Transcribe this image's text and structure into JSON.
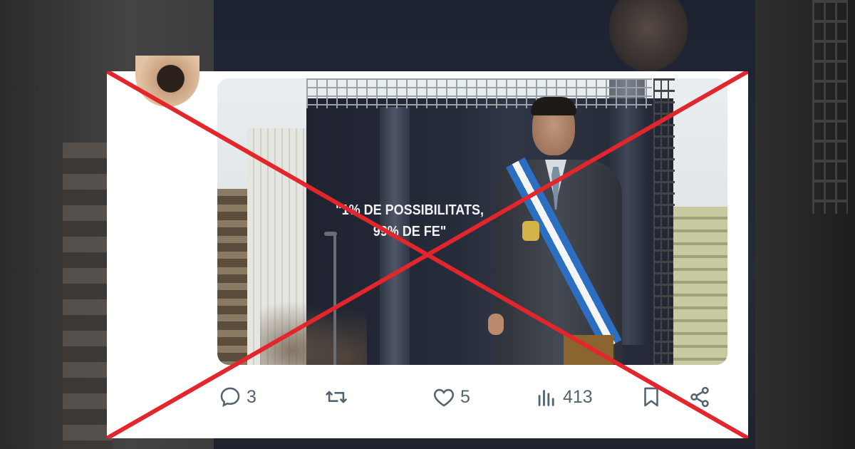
{
  "tweet": {
    "media": {
      "slogan_line1": "\"1% DE POSSIBILITATS,",
      "slogan_line2": "99% DE FE\""
    },
    "actions": {
      "replies": "3",
      "likes": "5",
      "views": "413"
    }
  },
  "overlay": {
    "color": "#e2262b"
  },
  "icons": [
    "reply-icon",
    "retweet-icon",
    "like-icon",
    "views-icon",
    "bookmark-icon",
    "share-icon"
  ]
}
